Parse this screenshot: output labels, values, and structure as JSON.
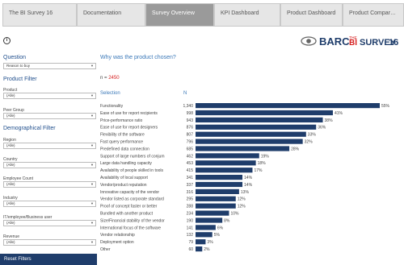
{
  "tabs": [
    {
      "label": "The BI Survey 16",
      "active": false
    },
    {
      "label": "Documentation",
      "active": false
    },
    {
      "label": "Survey Overview",
      "active": true
    },
    {
      "label": "KPI Dashboard",
      "active": false
    },
    {
      "label": "Product Dashboard",
      "active": false
    },
    {
      "label": "Product Compar…",
      "active": false
    }
  ],
  "info_icon": "i",
  "logo": {
    "barc": "BARC",
    "the": "THE",
    "bi": "BI",
    "survey": "SURVEY",
    "num": "16"
  },
  "sidebar": {
    "question_heading": "Question",
    "question_value": "Reason to buy",
    "product_filter_heading": "Product Filter",
    "product_label": "Product",
    "product_value": "(Alle)",
    "peer_group_label": "Peer Group",
    "peer_group_value": "(Alle)",
    "demo_filter_heading": "Demographical Filter",
    "region_label": "Region",
    "region_value": "(Alle)",
    "country_label": "Country",
    "country_value": "(Alle)",
    "employee_count_label": "Employee Count",
    "employee_count_value": "(Alle)",
    "industry_label": "Industry",
    "industry_value": "(Alle)",
    "it_label": "IT/employee/Business user",
    "it_value": "(Alle)",
    "revenue_label": "Revenue",
    "revenue_value": "(Alle)",
    "reset_label": "Reset Filters"
  },
  "main": {
    "question_title": "Why was the product chosen?",
    "n_prefix": "n = ",
    "n_value": "2450",
    "col_selection": "Selection",
    "col_n": "N"
  },
  "colors": {
    "bar": "#1f3d6b",
    "accent": "#3a78b8",
    "active_tab": "#9a9a9a"
  },
  "chart_data": {
    "type": "bar",
    "orientation": "horizontal",
    "categories": [
      "Functionality",
      "Ease of use for report recipients",
      "Price-performance ratio",
      "Ease of use for report designers",
      "Flexibility of the software",
      "Fast query performance",
      "Predefined data connection",
      "Support of large numbers of conjum",
      "Large data handling capacity",
      "Availability of people skilled in tools",
      "Availability of local support",
      "Vendor/product reputation",
      "Innovative capacity of the vendor",
      "Vendor listed as corporate standard",
      "Proof of concept faster or better",
      "Bundled with another product",
      "Size/Financial stability of the vendor",
      "International focus of the software",
      "Vendor relationship",
      "Deployment option",
      "Other"
    ],
    "n_values": [
      "1,340",
      "998",
      "943",
      "876",
      "807",
      "796",
      "685",
      "462",
      "453",
      "415",
      "341",
      "337",
      "316",
      "295",
      "288",
      "234",
      "190",
      "141",
      "132",
      "79",
      "60"
    ],
    "values": [
      55,
      41,
      38,
      36,
      33,
      32,
      28,
      19,
      18,
      17,
      14,
      14,
      13,
      12,
      12,
      10,
      8,
      6,
      5,
      3,
      2
    ],
    "value_labels": [
      "55%",
      "41%",
      "38%",
      "36%",
      "33%",
      "32%",
      "28%",
      "19%",
      "18%",
      "17%",
      "14%",
      "14%",
      "13%",
      "12%",
      "12%",
      "10%",
      "8%",
      "6%",
      "5%",
      "3%",
      "2%"
    ],
    "value_unit": "%",
    "grid": false
  }
}
